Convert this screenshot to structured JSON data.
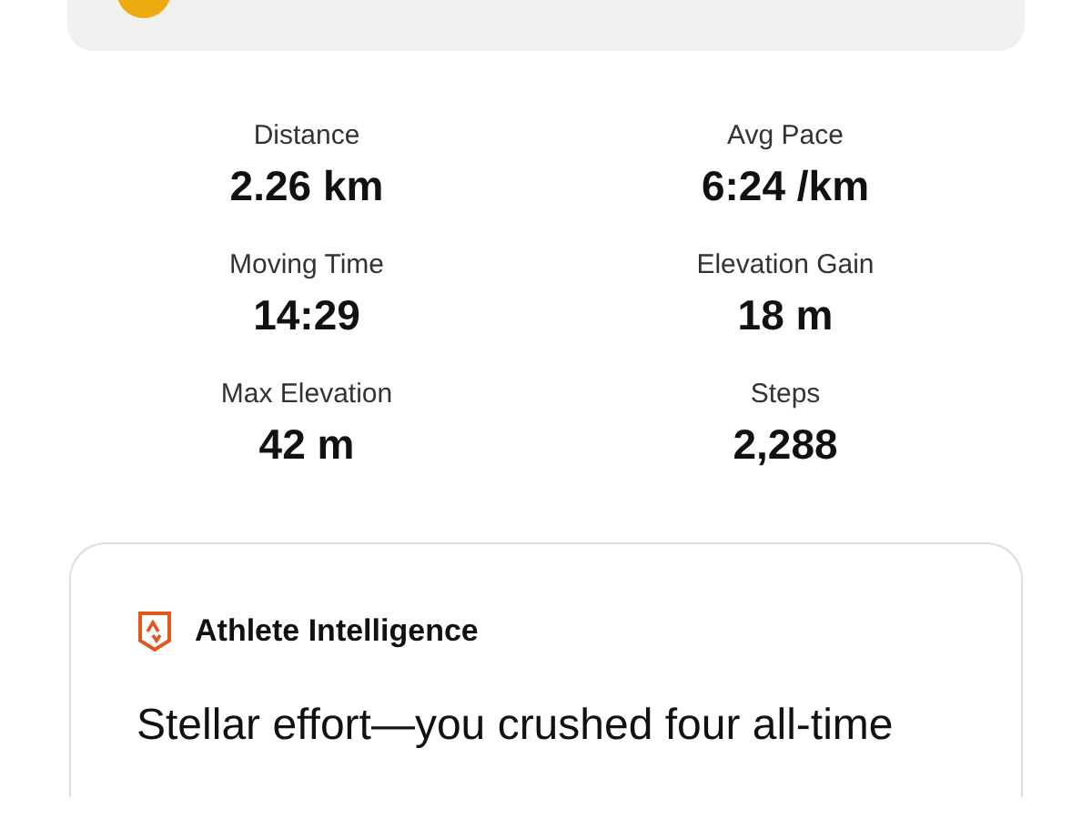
{
  "stats": [
    {
      "label": "Distance",
      "value": "2.26 km"
    },
    {
      "label": "Avg Pace",
      "value": "6:24 /km"
    },
    {
      "label": "Moving Time",
      "value": "14:29"
    },
    {
      "label": "Elevation Gain",
      "value": "18 m"
    },
    {
      "label": "Max Elevation",
      "value": "42 m"
    },
    {
      "label": "Steps",
      "value": "2,288"
    }
  ],
  "insight": {
    "title": "Athlete Intelligence",
    "text": "Stellar effort—you crushed four all-time"
  }
}
